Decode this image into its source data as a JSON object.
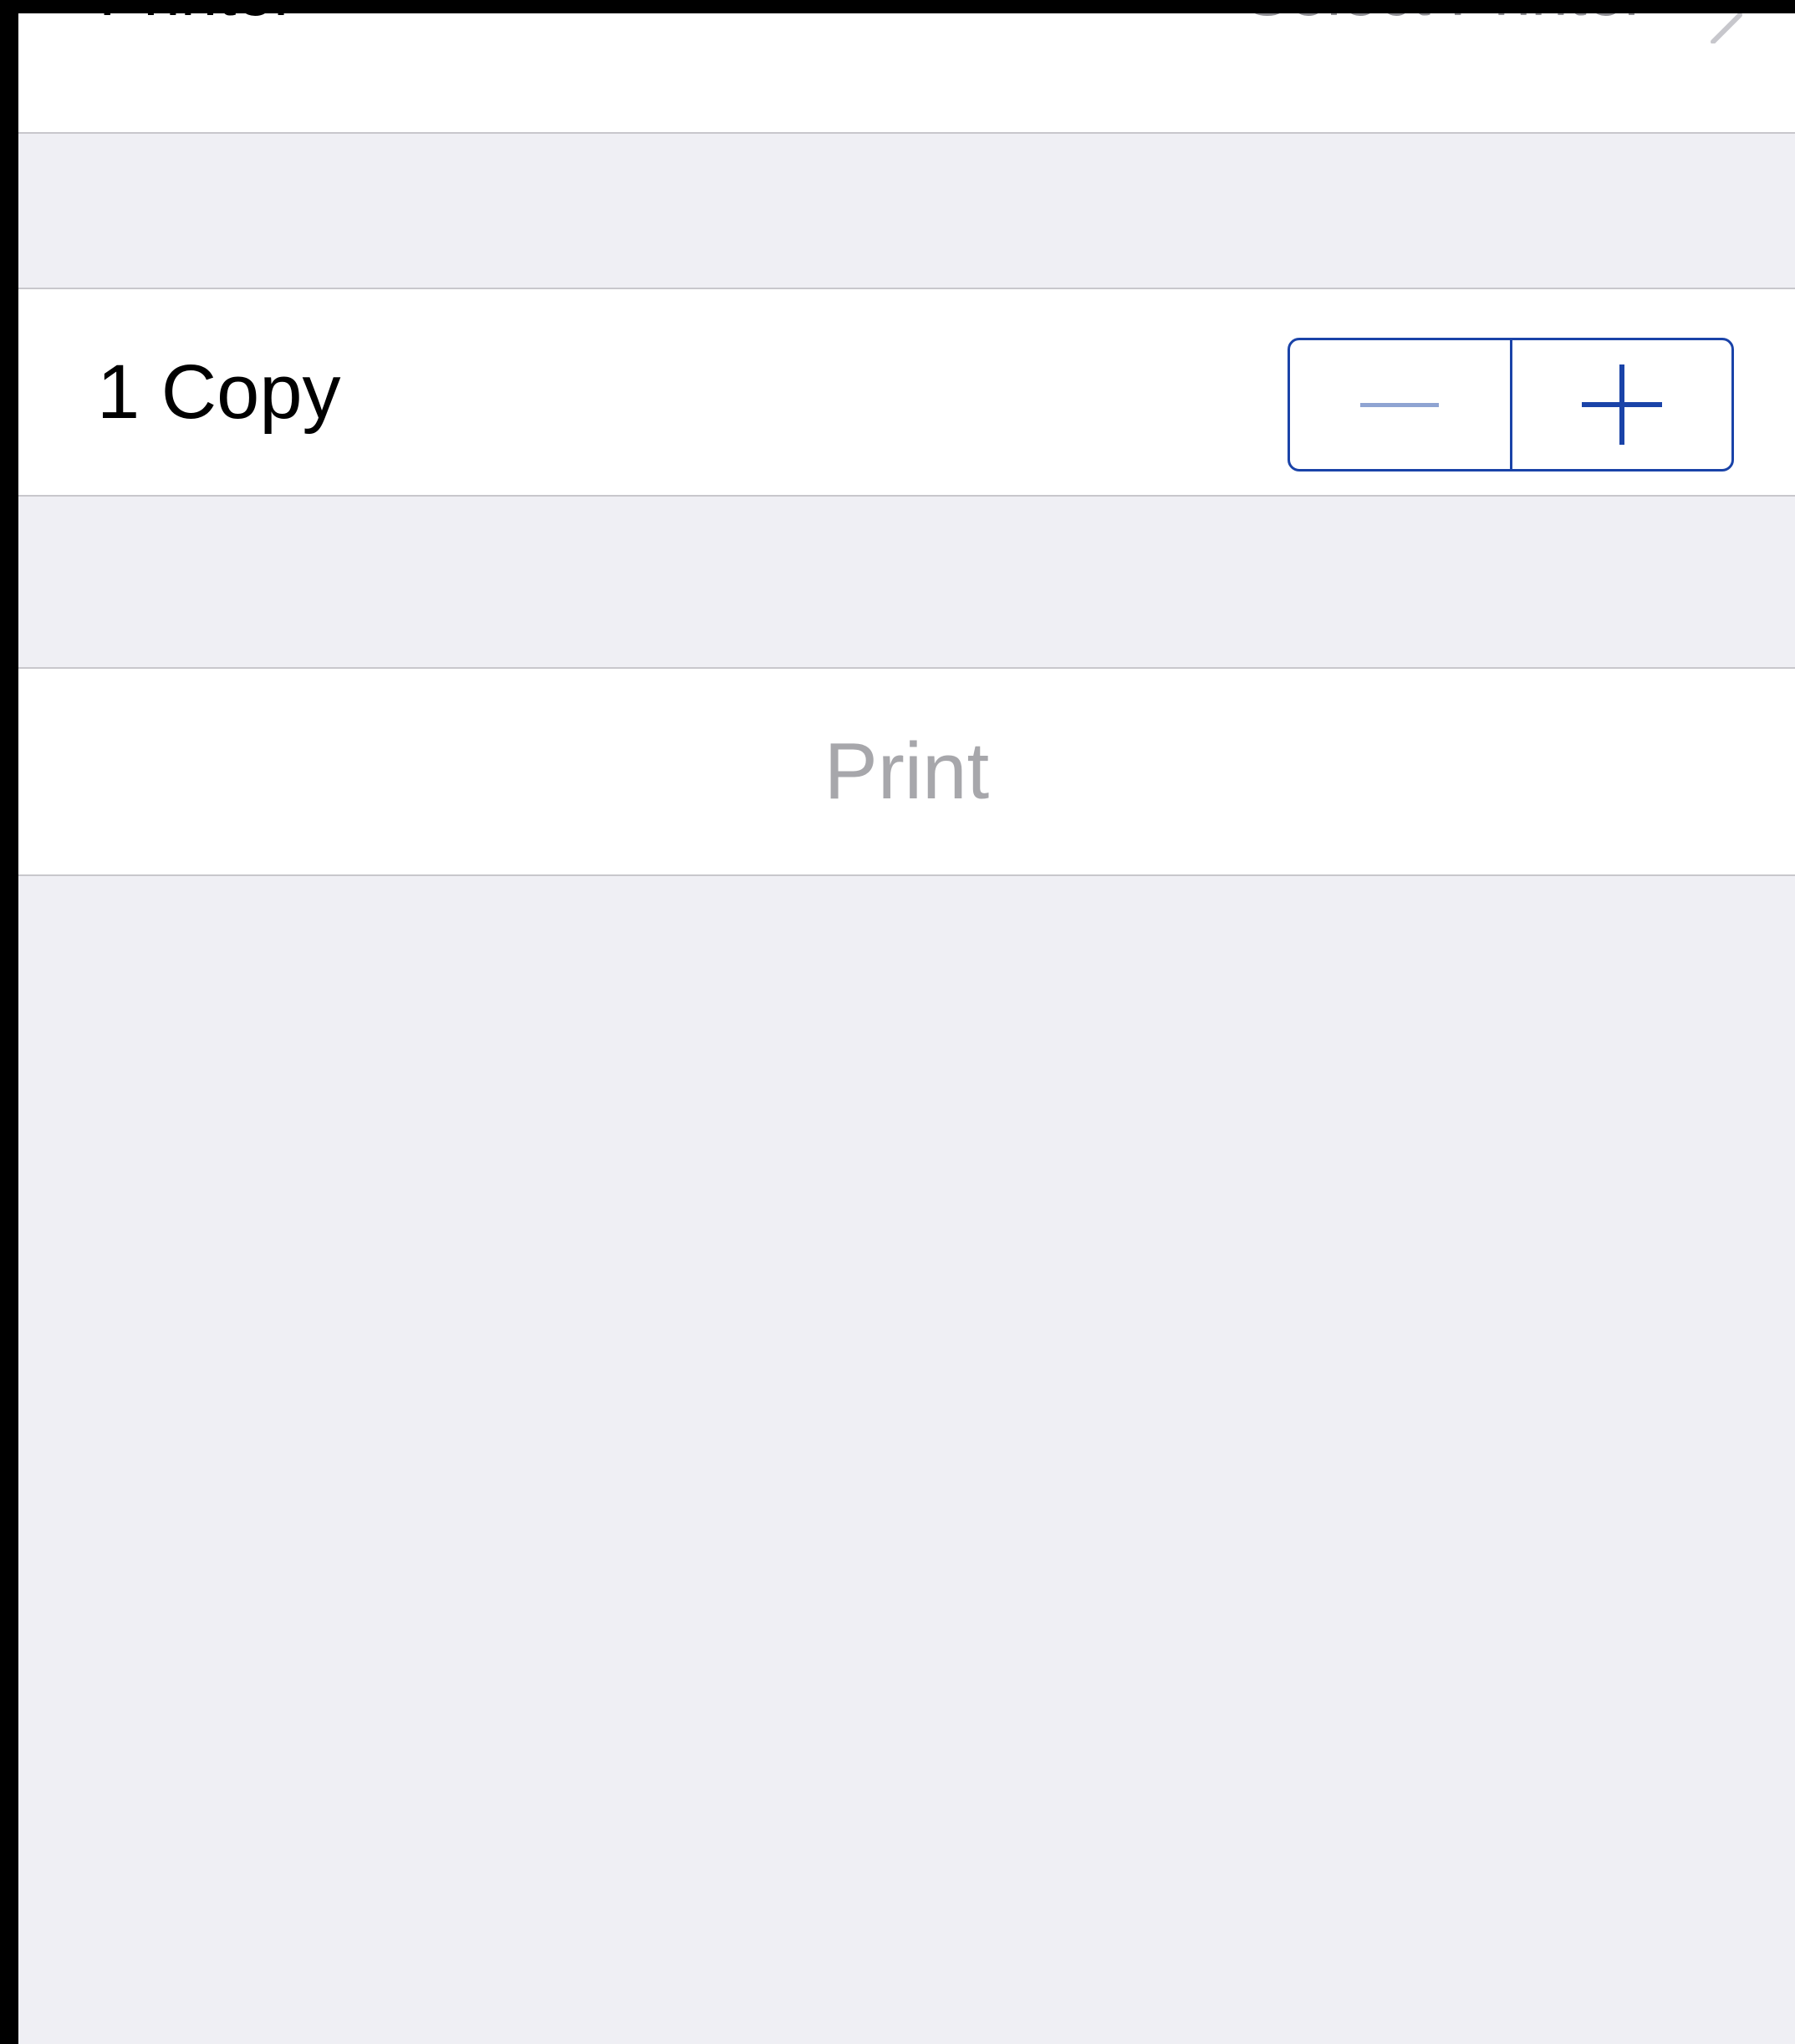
{
  "printer": {
    "label": "Printer",
    "value": "Select Printer"
  },
  "copies": {
    "label": "1 Copy",
    "stepper": {
      "decrement": "minus",
      "increment": "plus"
    }
  },
  "actions": {
    "print_label": "Print"
  },
  "colors": {
    "background": "#efeff4",
    "cell": "#ffffff",
    "separator": "#c8c7cc",
    "accent": "#1a43a8",
    "disabled_text": "#a7a7ab",
    "secondary_text": "#8e8e93"
  }
}
